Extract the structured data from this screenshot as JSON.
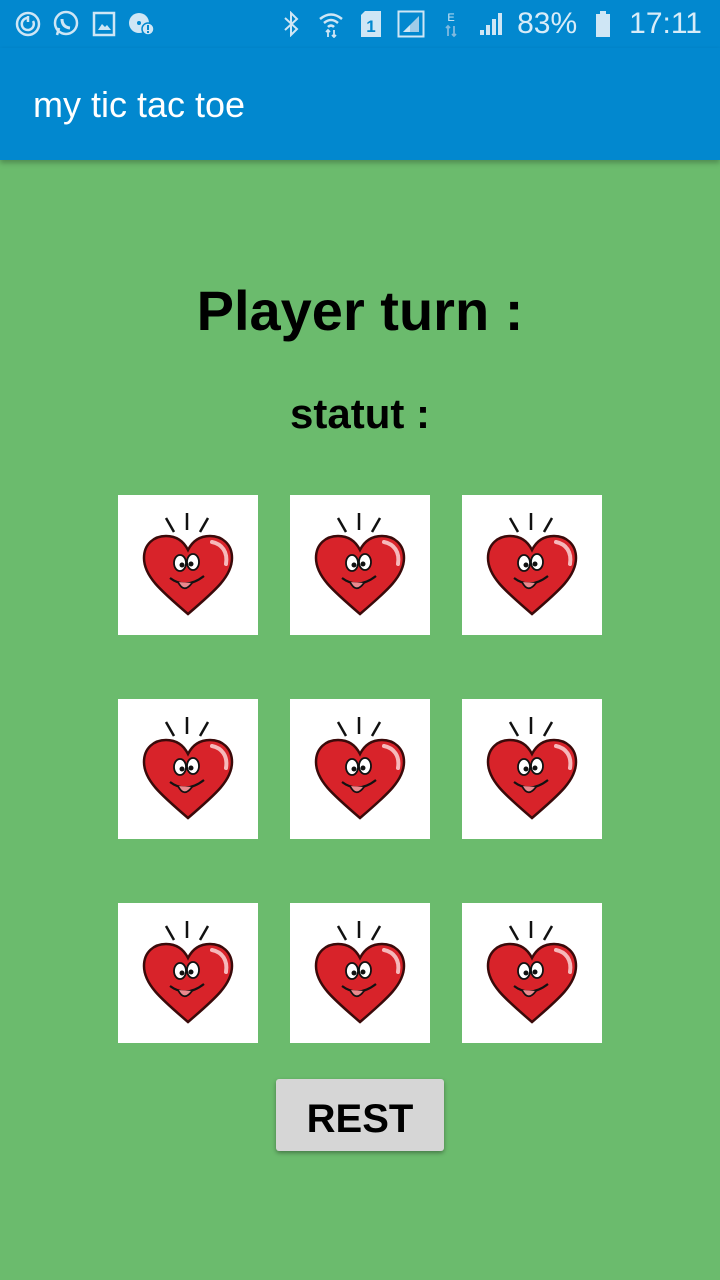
{
  "status_bar": {
    "left_icons": [
      "sync-icon",
      "whatsapp-icon",
      "gallery-icon",
      "alert-disc-icon"
    ],
    "right_icons": [
      "bluetooth-icon",
      "wifi-icon",
      "sim-1-icon",
      "signal-box-icon",
      "edge-data-icon",
      "signal-icon"
    ],
    "battery": "83%",
    "time": "17:11"
  },
  "app_bar": {
    "title": "my tic tac toe"
  },
  "game": {
    "player_turn_label": "Player turn :",
    "statut_label": "statut :",
    "cells": [
      {
        "content": "heart-face"
      },
      {
        "content": "heart-face"
      },
      {
        "content": "heart-face"
      },
      {
        "content": "heart-face"
      },
      {
        "content": "heart-face"
      },
      {
        "content": "heart-face"
      },
      {
        "content": "heart-face"
      },
      {
        "content": "heart-face"
      },
      {
        "content": "heart-face"
      }
    ],
    "reset_button_label": "REST"
  },
  "colors": {
    "primary": "#0288cf",
    "background": "#6bbb6d",
    "heart": "#d8232a",
    "button": "#d6d6d6"
  }
}
